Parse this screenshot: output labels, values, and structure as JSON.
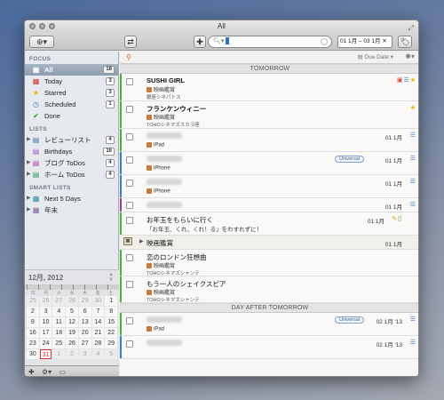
{
  "window": {
    "title": "All"
  },
  "toolbar": {
    "search_placeholder": "",
    "date_range": "01 1月 – 03 1月"
  },
  "sidebar": {
    "focus_header": "FOCUS",
    "focus_items": [
      {
        "label": "All",
        "count": "18",
        "icon": "inbox-icon"
      },
      {
        "label": "Today",
        "count": "3",
        "icon": "calendar-icon"
      },
      {
        "label": "Starred",
        "count": "3",
        "icon": "star-icon"
      },
      {
        "label": "Scheduled",
        "count": "1",
        "icon": "clock-icon"
      },
      {
        "label": "Done",
        "count": "",
        "icon": "check-icon"
      }
    ],
    "lists_header": "LISTS",
    "lists": [
      {
        "label": "レビューリスト",
        "count": "4"
      },
      {
        "label": "Birthdays",
        "count": "16"
      },
      {
        "label": "ブログ ToDos",
        "count": "4"
      },
      {
        "label": "ホーム ToDos",
        "count": "4"
      }
    ],
    "smart_header": "SMART LISTS",
    "smart": [
      {
        "label": "Next 5 Days"
      },
      {
        "label": "年末"
      }
    ]
  },
  "calendar": {
    "title": "12月, 2012",
    "dow": [
      "日",
      "月",
      "火",
      "水",
      "木",
      "金",
      "土"
    ],
    "days": [
      "25",
      "26",
      "27",
      "28",
      "29",
      "30",
      "1",
      "2",
      "3",
      "4",
      "5",
      "6",
      "7",
      "8",
      "9",
      "10",
      "11",
      "12",
      "13",
      "14",
      "15",
      "16",
      "17",
      "18",
      "19",
      "20",
      "21",
      "22",
      "23",
      "24",
      "25",
      "26",
      "27",
      "28",
      "29",
      "30",
      "31",
      "1",
      "2",
      "3",
      "4",
      "5"
    ]
  },
  "list": {
    "sort_label": "Due Date",
    "group_tomorrow": "TOMORROW",
    "group_day_after": "DAY AFTER TOMORROW",
    "rows": [
      {
        "title": "SUSHI GIRL",
        "tag": "映画鑑賞",
        "sub": "銀座シネパトス"
      },
      {
        "title": "フランケンウィニー",
        "tag": "映画鑑賞",
        "sub": "TOHOシネマズスカラ座"
      },
      {
        "tag": "iPad",
        "date": "01 1月"
      },
      {
        "tag": "iPhone",
        "date": "01 1月",
        "pill": "Universal"
      },
      {
        "tag": "iPhone",
        "date": "01 1月"
      },
      {
        "date": "01 1月"
      },
      {
        "title": "お年玉をもらいに行く",
        "note": "「お年玉、くれ、くれ！る」をわすれずに！",
        "date": "01 1月"
      },
      {
        "title": "映画鑑賞",
        "date": "01 1月"
      },
      {
        "title": "恋のロンドン狂想曲",
        "tag": "映画鑑賞",
        "sub": "TOHOシネマズシャンテ"
      },
      {
        "title": "もう一人のシェイクスピア",
        "tag": "映画鑑賞",
        "sub": "TOHOシネマズシャンテ"
      },
      {
        "date": "02 1月 '13",
        "pill": "Universal",
        "tag": "iPad"
      },
      {
        "date": "02 1月 '13"
      }
    ]
  }
}
